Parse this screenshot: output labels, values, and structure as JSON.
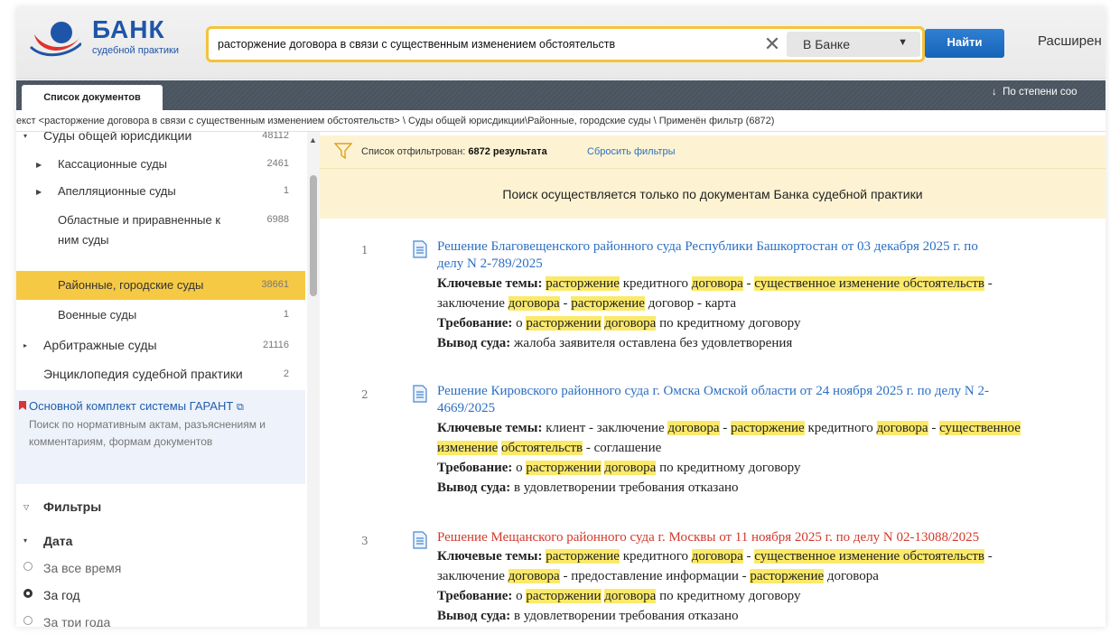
{
  "header": {
    "logo_title": "БАНК",
    "logo_subtitle": "судебной практики",
    "search_value": "расторжение договора в связи с существенным изменением обстоятельств",
    "clear_symbol": "✕",
    "scope_label": "В Банке",
    "find_label": "Найти",
    "advanced_label": "Расширен"
  },
  "tabbar": {
    "tab_label": "Список документов",
    "sort_label": "По степени соо"
  },
  "breadcrumb": "екст <расторжение договора в связи с существенным изменением обстоятельств> \\ Суды общей юрисдикции\\Районные, городские суды \\ Применён фильтр (6872)",
  "sidebar": {
    "items": [
      {
        "label": "Суды общей юрисдикции",
        "count": "48112"
      },
      {
        "label": "Кассационные суды",
        "count": "2461"
      },
      {
        "label": "Апелляционные суды",
        "count": "1"
      },
      {
        "label": "Областные и приравненные к ним суды",
        "count": "6988"
      },
      {
        "label": "Районные, городские суды",
        "count": "38661"
      },
      {
        "label": "Военные суды",
        "count": "1"
      },
      {
        "label": "Арбитражные суды",
        "count": "21116"
      },
      {
        "label": "Энциклопедия судебной практики",
        "count": "2"
      }
    ],
    "garant": {
      "title": "Основной комплект системы ГАРАНТ",
      "description": "Поиск по нормативным актам, разъяснениям и комментариям, формам документов"
    },
    "filters_label": "Фильтры",
    "date_label": "Дата",
    "date_options": [
      "За все время",
      "За год",
      "За три года"
    ],
    "date_selected": "За год"
  },
  "main": {
    "filter_prefix": "Список отфильтрован:",
    "filter_count": "6872 результата",
    "reset_label": "Сбросить фильтры",
    "notice": "Поиск осуществляется только по документам Банка судебной практики",
    "labels": {
      "themes": "Ключевые темы:",
      "requirement": "Требование:",
      "conclusion": "Вывод суда:"
    },
    "results": [
      {
        "num": "1",
        "title_l1": "Решение Благовещенского районного суда Республики Башкортостан от 03 декабря 2025 г. по",
        "title_l2": "делу N 2-789/2025",
        "req_rest": "по кредитному договору",
        "conclusion": "жалоба заявителя оставлена без удовлетворения"
      },
      {
        "num": "2",
        "title_l1": "Решение Кировского районного суда г. Омска Омской области от 24 ноября 2025 г. по делу N 2-",
        "title_l2": "4669/2025",
        "req_rest": "по кредитному договору",
        "conclusion": "в удовлетворении требования отказано"
      },
      {
        "num": "3",
        "title_l1": "Решение Мещанского районного суда г. Москвы от 11 ноября 2025 г. по делу N 02-13088/2025",
        "req_rest": "по кредитному договору",
        "conclusion": "в удовлетворении требования отказано"
      }
    ],
    "words": {
      "rastorzhenie": "расторжение",
      "rastorzhenii": "расторжении",
      "dogovora": "договора",
      "sush_izm_obst": "существенное изменение обстоятельств",
      "sush": "существенное",
      "izm": "изменение",
      "obst": "обстоятельств",
      "kreditnogo": "кредитного",
      "o": "о",
      "dash": "-",
      "zaklyuchenie": "заключение",
      "dogovor_karta": "договор - карта",
      "klient_zakl": "клиент - заключение",
      "soglashenie": "- соглашение",
      "predost": "- предоставление информации -",
      "dogovora_plain": "договора"
    }
  },
  "colors": {
    "accent_blue": "#2c6fc2",
    "highlight_yellow": "#fbe96a",
    "active_item": "#f6c945",
    "search_border": "#f4c33a"
  }
}
